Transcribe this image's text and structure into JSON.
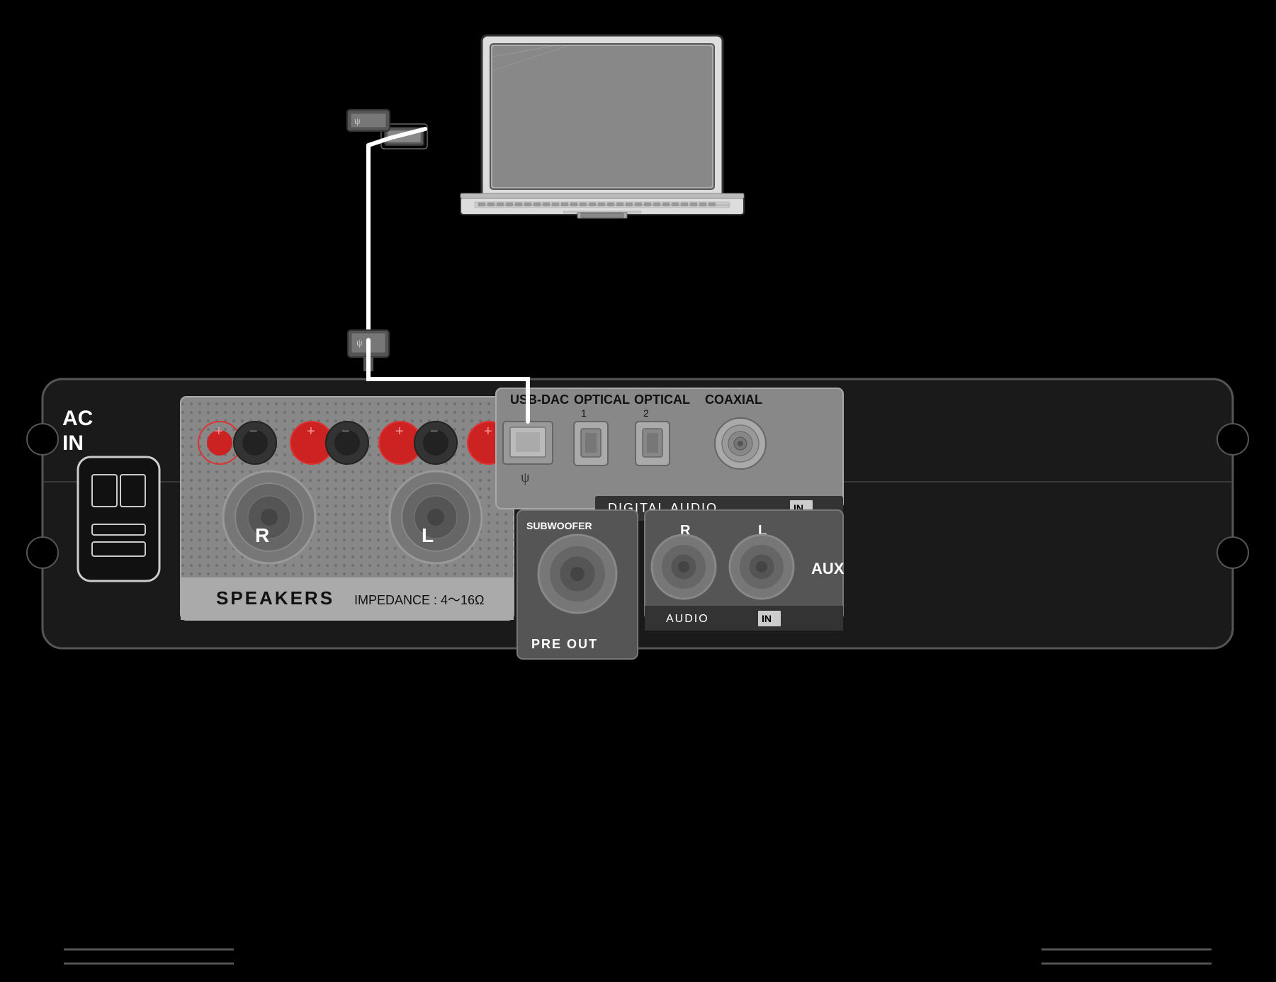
{
  "background": "#000000",
  "laptop": {
    "label": "Laptop computer"
  },
  "cable": {
    "usb_symbol": "ψ",
    "description": "USB cable connecting laptop to amplifier"
  },
  "amplifier": {
    "ac_in": {
      "label_line1": "AC",
      "label_line2": "IN"
    },
    "speakers": {
      "label": "SPEAKERS",
      "impedance": "IMPEDANCE : 4～16Ω",
      "left_label": "L",
      "right_label": "R"
    },
    "digital_audio": {
      "label": "DIGITAL AUDIO",
      "in_badge": "IN",
      "ports": [
        {
          "label": "USB-DAC",
          "type": "usb"
        },
        {
          "label": "OPTICAL\n1",
          "type": "optical"
        },
        {
          "label": "OPTICAL\n2",
          "type": "optical"
        },
        {
          "label": "COAXIAL",
          "type": "coaxial"
        }
      ]
    },
    "pre_out": {
      "label": "PRE OUT",
      "subwoofer_label": "SUBWOOFER"
    },
    "audio_in": {
      "label": "AUDIO",
      "in_badge": "IN",
      "aux_label": "AUX",
      "left_label": "L",
      "right_label": "R"
    }
  },
  "bottom_lines": {
    "left_label": "",
    "right_label": ""
  }
}
